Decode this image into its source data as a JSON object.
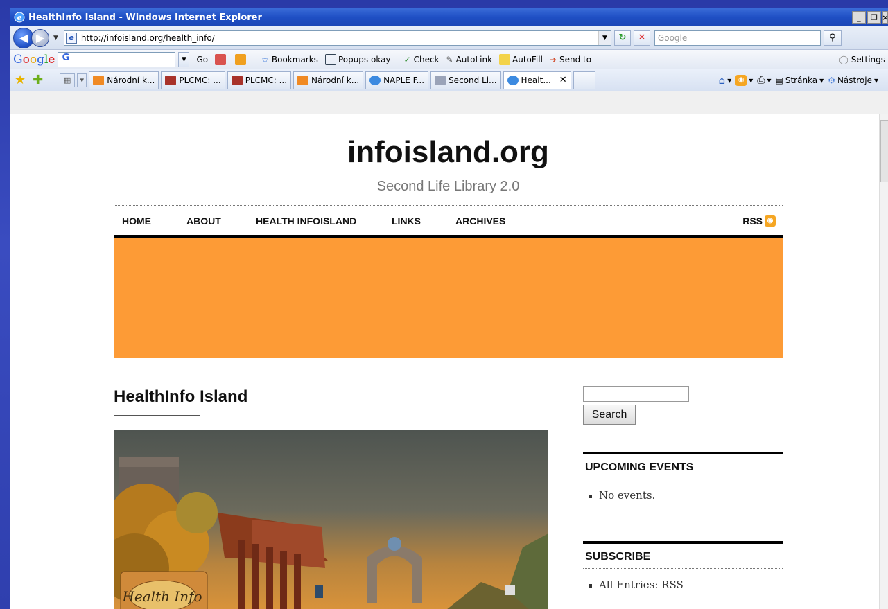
{
  "window": {
    "title": "HealthInfo Island - Windows Internet Explorer",
    "controls": [
      "_",
      "̥"
    ]
  },
  "address_bar": {
    "url": "http://infoisland.org/health_info/",
    "search_placeholder": "Google"
  },
  "google_toolbar": {
    "go_label": "Go",
    "bookmarks_label": "Bookmarks",
    "popups_label": "Popups okay",
    "check_label": "Check",
    "autolink_label": "AutoLink",
    "autofill_label": "AutoFill",
    "sendto_label": "Send to",
    "settings_label": "Settings"
  },
  "tabs": [
    {
      "label": "Národní k...",
      "icon": "book-icon"
    },
    {
      "label": "PLCMC: ...",
      "icon": "library-icon"
    },
    {
      "label": "PLCMC: ...",
      "icon": "library-icon"
    },
    {
      "label": "Národní k...",
      "icon": "book-icon"
    },
    {
      "label": "NAPLE F...",
      "icon": "ie-icon"
    },
    {
      "label": "Second Li...",
      "icon": "hand-icon"
    },
    {
      "label": "Healt...",
      "icon": "ie-icon",
      "active": true
    }
  ],
  "tab_tools": {
    "page_label": "Stránka",
    "tools_label": "Nástroje"
  },
  "site": {
    "title": "infoisland.org",
    "tagline": "Second Life Library 2.0",
    "nav": [
      "HOME",
      "ABOUT",
      "HEALTH INFOISLAND",
      "LINKS",
      "ARCHIVES"
    ],
    "rss_label": "RSS",
    "banner_color": "#fd9b36"
  },
  "post": {
    "title": "HealthInfo Island",
    "image_sign": "Health Info"
  },
  "sidebar": {
    "search_button": "Search",
    "events_title": "UPCOMING EVENTS",
    "events_items": [
      "No events."
    ],
    "subscribe_title": "SUBSCRIBE",
    "subscribe_items": [
      "All Entries: RSS"
    ]
  }
}
